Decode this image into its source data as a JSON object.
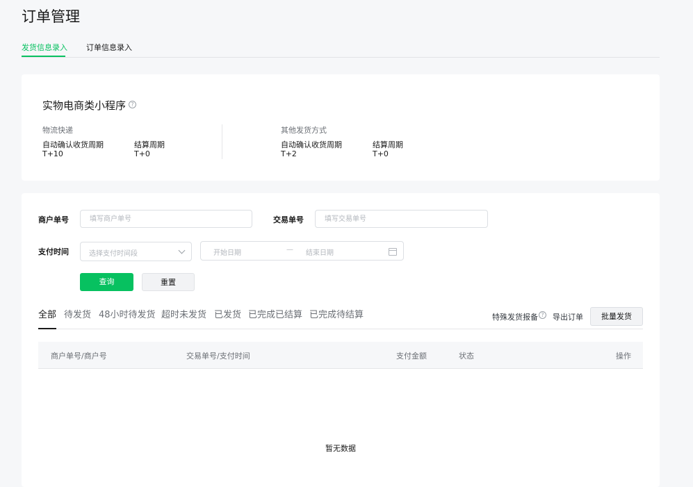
{
  "page": {
    "title": "订单管理"
  },
  "top_tabs": [
    {
      "label": "发货信息录入",
      "active": true
    },
    {
      "label": "订单信息录入",
      "active": false
    }
  ],
  "info_card": {
    "title": "实物电商类小程序",
    "help_icon": "question-circle-icon",
    "columns": [
      {
        "title": "物流快递",
        "items": [
          {
            "label": "自动确认收货周期",
            "value": "T+10"
          },
          {
            "label": "结算周期",
            "value": "T+0"
          }
        ]
      },
      {
        "title": "其他发货方式",
        "items": [
          {
            "label": "自动确认收货周期",
            "value": "T+2"
          },
          {
            "label": "结算周期",
            "value": "T+0"
          }
        ]
      }
    ]
  },
  "filters": {
    "merchant_order": {
      "label": "商户单号",
      "placeholder": "填写商户单号"
    },
    "transaction_order": {
      "label": "交易单号",
      "placeholder": "填写交易单号"
    },
    "pay_time": {
      "label": "支付时间",
      "select_placeholder": "选择支付时间段",
      "start_placeholder": "开始日期",
      "separator": "—",
      "end_placeholder": "结束日期"
    },
    "query_button": "查询",
    "reset_button": "重置"
  },
  "status_tabs": [
    {
      "label": "全部",
      "active": true
    },
    {
      "label": "待发货",
      "active": false
    },
    {
      "label": "48小时待发货",
      "active": false
    },
    {
      "label": "超时未发货",
      "active": false
    },
    {
      "label": "已发货",
      "active": false
    },
    {
      "label": "已完成已结算",
      "active": false
    },
    {
      "label": "已完成待结算",
      "active": false
    }
  ],
  "actions": {
    "special_report": "特殊发货报备",
    "export": "导出订单",
    "batch_ship": "批量发货"
  },
  "table": {
    "columns": [
      "商户单号/商户号",
      "交易单号/支付时间",
      "支付金额",
      "状态",
      "操作"
    ],
    "empty_text": "暂无数据"
  },
  "colors": {
    "accent": "#07c160",
    "background": "#f6f7f9"
  }
}
